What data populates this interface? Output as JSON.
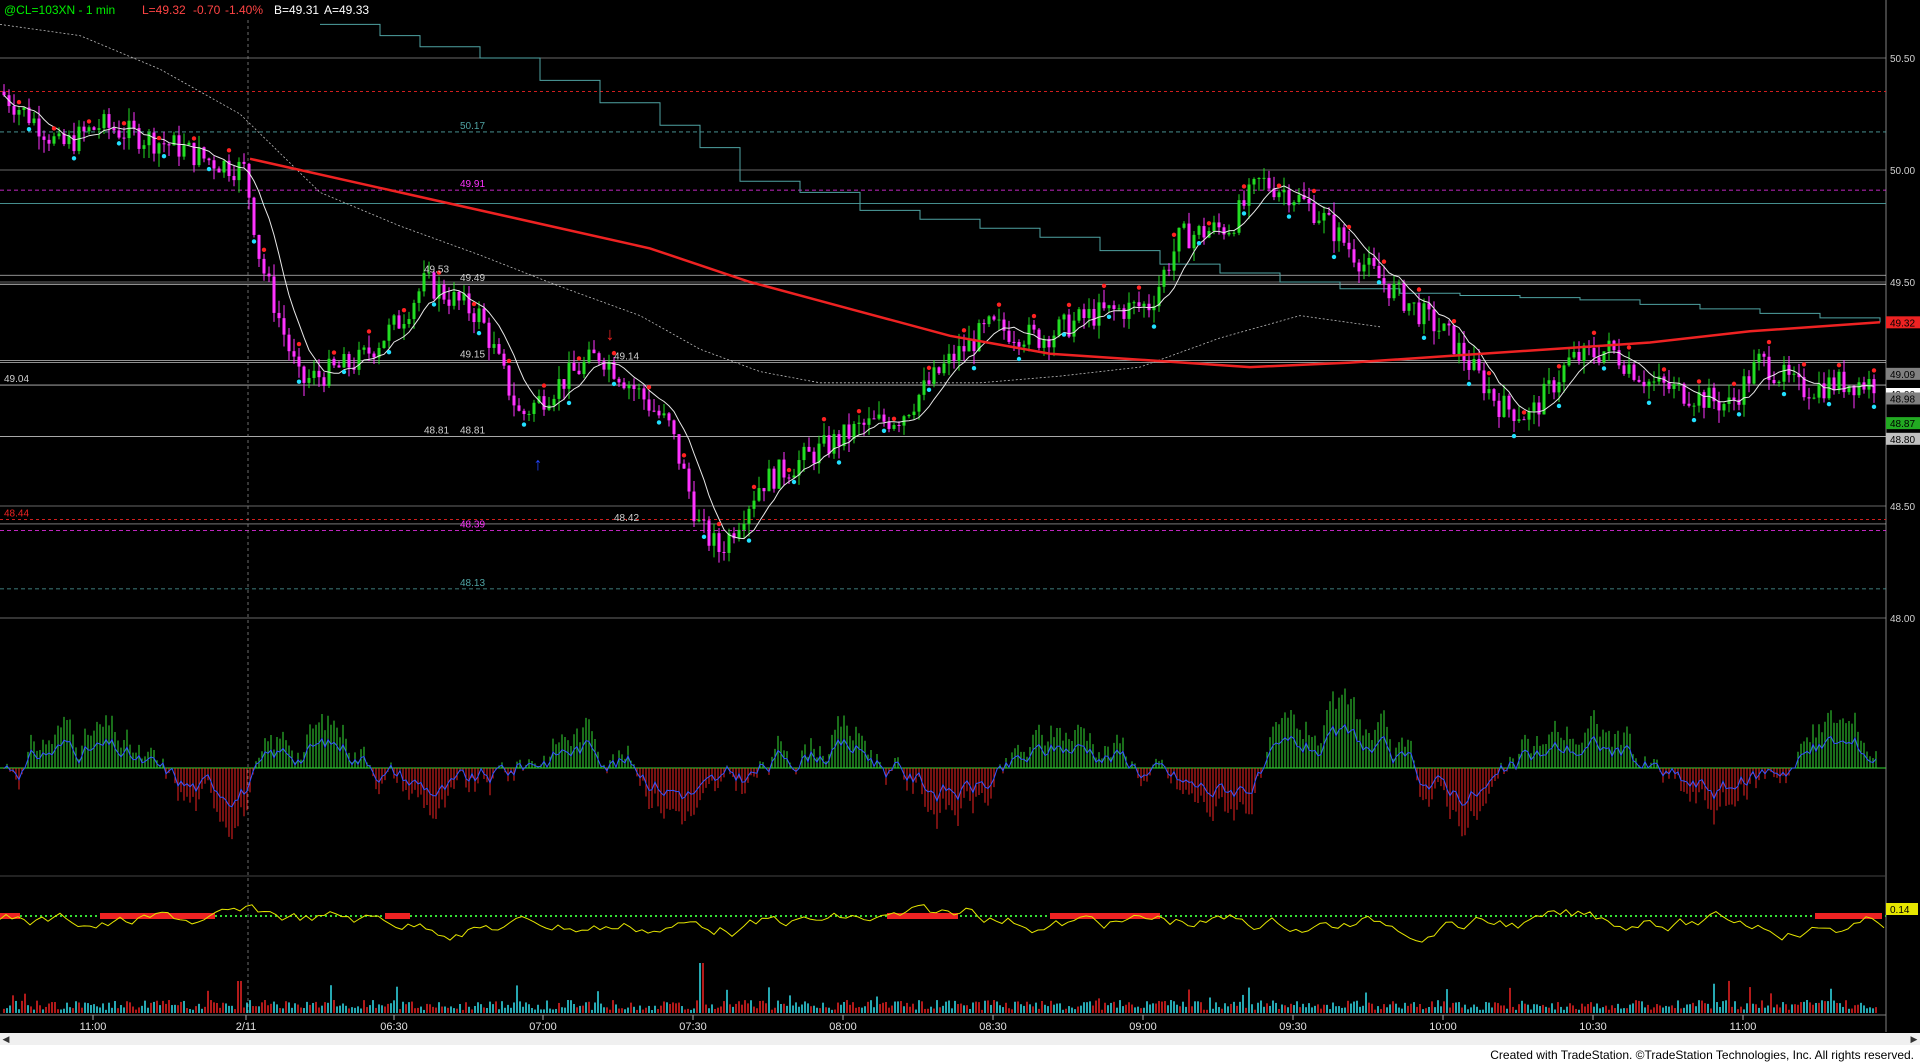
{
  "header": {
    "symbol": "@CL=103XN - 1 min",
    "last": "L=49.32",
    "change": "-0.70",
    "change_pct": "-1.40%",
    "bid": "B=49.31",
    "ask": "A=49.33"
  },
  "footer": {
    "copyright": "Created with TradeStation. ©TradeStation Technologies, Inc. All rights reserved."
  },
  "colors": {
    "background": "#000000",
    "up_candle": "#22dd22",
    "down_candle": "#ff33ff",
    "ma_long": "#ee2222",
    "ma_short": "#e8e8e8",
    "teal_line": "#4fa3a3",
    "swing_high_dot": "#ff2222",
    "swing_low_dot": "#22e0ff",
    "histogram_up": "#33dd33",
    "histogram_down": "#ee2222",
    "volume_up": "#33e0ee",
    "volume_down": "#ee2222"
  },
  "chart_data": {
    "type": "candlestick",
    "ylim": [
      47.95,
      50.65
    ],
    "y_ticks": [
      "50.50",
      "50.00",
      "49.50",
      "48.50",
      "48.00"
    ],
    "x_ticks": [
      "11:00",
      "2/11",
      "06:30",
      "07:00",
      "07:30",
      "08:00",
      "08:30",
      "09:00",
      "09:30",
      "10:00",
      "10:30",
      "11:00"
    ],
    "close_path": [
      [
        0,
        49.37
      ],
      [
        18,
        49.2
      ],
      [
        34,
        49.32
      ],
      [
        58,
        49.13
      ],
      [
        70,
        48.95
      ],
      [
        82,
        48.85
      ],
      [
        100,
        48.95
      ],
      [
        112,
        49.18
      ],
      [
        126,
        49.4
      ],
      [
        134,
        49.3
      ],
      [
        146,
        49.12
      ],
      [
        160,
        48.95
      ],
      [
        172,
        48.83
      ],
      [
        182,
        49.05
      ],
      [
        200,
        49.1
      ],
      [
        214,
        48.88
      ],
      [
        220,
        48.65
      ],
      [
        236,
        48.85
      ],
      [
        248,
        48.95
      ],
      [
        256,
        48.8
      ],
      [
        266,
        48.92
      ],
      [
        278,
        49.05
      ],
      [
        294,
        49.2
      ],
      [
        312,
        49.35
      ],
      [
        322,
        49.15
      ],
      [
        334,
        49.05
      ],
      [
        346,
        49.05
      ],
      [
        362,
        49.2
      ],
      [
        378,
        49.33
      ],
      [
        392,
        49.36
      ],
      [
        402,
        49.28
      ],
      [
        414,
        49.26
      ],
      [
        422,
        49.32
      ],
      [
        438,
        49.37
      ],
      [
        452,
        49.2
      ],
      [
        468,
        49.35
      ],
      [
        478,
        49.4
      ],
      [
        490,
        49.25
      ],
      [
        502,
        49.35
      ],
      [
        514,
        49.32
      ],
      [
        528,
        49.25
      ],
      [
        548,
        49.28
      ],
      [
        566,
        49.27
      ],
      [
        582,
        49.22
      ],
      [
        600,
        49.21
      ],
      [
        618,
        49.2
      ],
      [
        628,
        49.18
      ]
    ],
    "extra_y_labels": [
      "48.87",
      "48.80"
    ],
    "swing_labels": [
      {
        "text": "49.53",
        "x": 29,
        "y": 49.53
      },
      {
        "text": "49.49",
        "x": 31,
        "y": 49.49
      },
      {
        "text": "49.15",
        "x": 31,
        "y": 49.15
      },
      {
        "text": "48.81",
        "x": 29,
        "y": 48.81
      },
      {
        "text": "48.81",
        "x": 31,
        "y": 48.81
      },
      {
        "text": "49.14",
        "x": 41,
        "y": 49.14
      },
      {
        "text": "48.42",
        "x": 41,
        "y": 48.42
      },
      {
        "text": "50.17",
        "x": 31,
        "y": 50.17
      },
      {
        "text": "49.91",
        "x": 31,
        "y": 49.91
      },
      {
        "text": "48.39",
        "x": 31,
        "y": 48.39
      },
      {
        "text": "48.13",
        "x": 31,
        "y": 48.13
      },
      {
        "text": "49.04",
        "x": 0,
        "y": 49.04
      },
      {
        "text": "48.44",
        "x": 0,
        "y": 48.44
      }
    ],
    "right_side_labels": [
      "49.32",
      "49.09",
      "49.00",
      "48.98",
      "48.87",
      "48.80"
    ],
    "subpanel_label": "0.14"
  }
}
